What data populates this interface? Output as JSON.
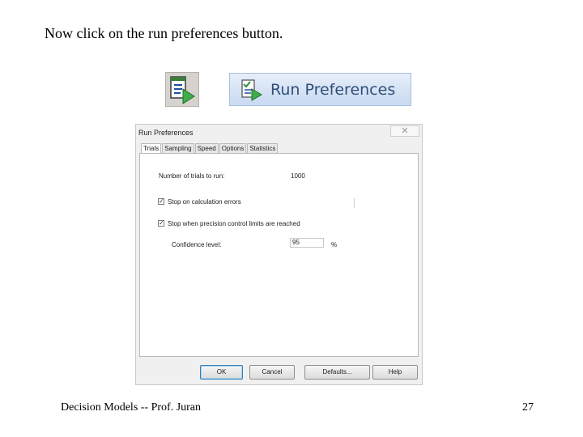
{
  "slide": {
    "title": "Now click on the run preferences button.",
    "footer_left": "Decision Models -- Prof. Juran",
    "page_number": "27"
  },
  "ribbon": {
    "label": "Run Preferences",
    "small_icon": "run-preferences-icon"
  },
  "dialog": {
    "title": "Run Preferences",
    "close_glyph": "✕",
    "tabs": [
      "Trials",
      "Sampling",
      "Speed",
      "Options",
      "Statistics"
    ],
    "active_tab": "Trials",
    "trials_label": "Number of trials to run:",
    "trials_value": "1000",
    "stop_errors_label": "Stop on calculation errors",
    "stop_errors_checked": true,
    "stop_precision_label": "Stop when precision control limits are reached",
    "stop_precision_checked": true,
    "confidence_label": "Confidence level:",
    "confidence_value": "95",
    "confidence_unit": "%",
    "buttons": {
      "ok": "OK",
      "cancel": "Cancel",
      "defaults": "Defaults...",
      "help": "Help"
    },
    "accent_color": "#3c7fb1"
  }
}
